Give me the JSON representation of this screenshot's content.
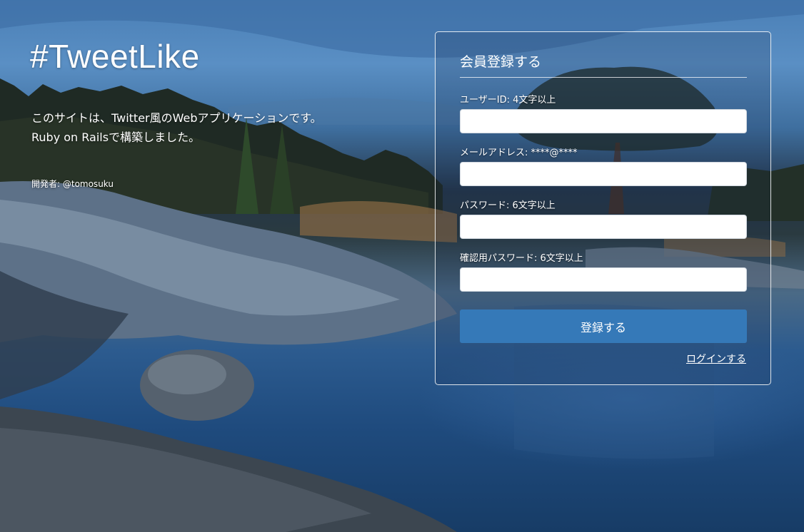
{
  "brand": {
    "title": "#TweetLike"
  },
  "intro": {
    "line1": "このサイトは、Twitter風のWebアプリケーションです。",
    "line2": "Ruby on Railsで構築しました。"
  },
  "developer": {
    "text": "開発者: @tomosuku"
  },
  "signup": {
    "heading": "会員登録する",
    "fields": [
      {
        "label": "ユーザーID: 4文字以上",
        "value": "",
        "placeholder": ""
      },
      {
        "label": "メールアドレス: ****@****",
        "value": "",
        "placeholder": ""
      },
      {
        "label": "パスワード: 6文字以上",
        "value": "",
        "placeholder": ""
      },
      {
        "label": "確認用パスワード: 6文字以上",
        "value": "",
        "placeholder": ""
      }
    ],
    "submit_label": "登録する",
    "login_link": "ログインする"
  },
  "colors": {
    "button": "#3579b8",
    "text": "#ffffff"
  }
}
